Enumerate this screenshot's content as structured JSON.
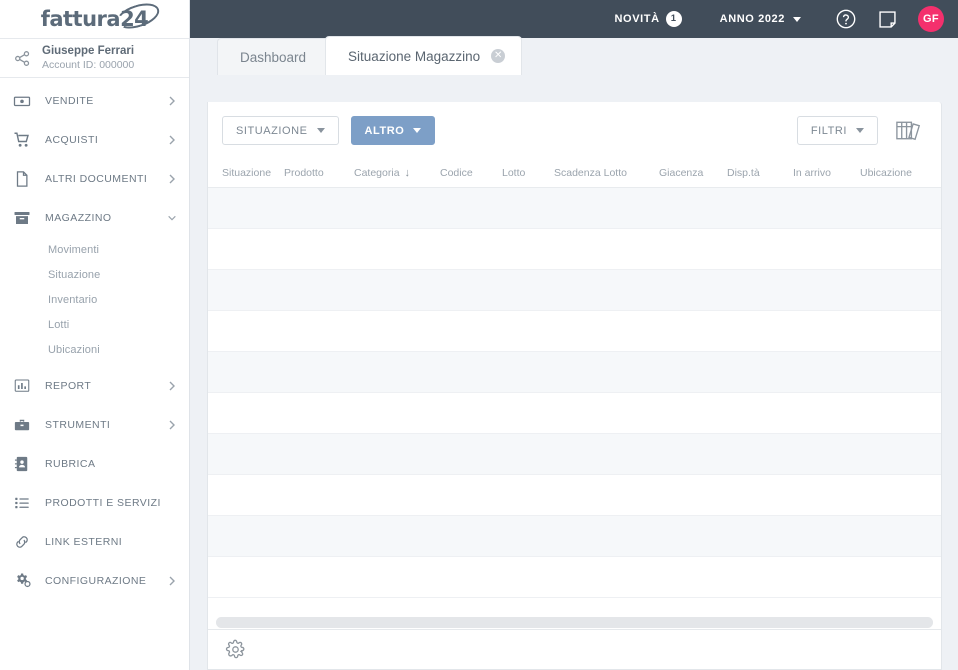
{
  "brand": {
    "logo_text": "fattura24",
    "logo_main": "fattura",
    "logo_suffix": "24"
  },
  "account": {
    "icon": "share-nodes-icon",
    "name": "Giuseppe Ferrari",
    "id_label": "Account ID: 000000"
  },
  "topbar": {
    "novita_label": "NOVITÀ",
    "novita_count": "1",
    "anno_label": "ANNO 2022",
    "help_icon": "question-circle-icon",
    "note_icon": "note-icon",
    "avatar_initials": "GF",
    "background": "#414d5a",
    "avatar_color": "#f4306d"
  },
  "sidebar": {
    "items": [
      {
        "label": "VENDITE",
        "icon": "banknote-icon",
        "expandable": true,
        "expanded": false
      },
      {
        "label": "ACQUISTI",
        "icon": "cart-icon",
        "expandable": true,
        "expanded": false
      },
      {
        "label": "ALTRI DOCUMENTI",
        "icon": "document-icon",
        "expandable": true,
        "expanded": false
      },
      {
        "label": "MAGAZZINO",
        "icon": "archive-box-icon",
        "expandable": true,
        "expanded": true
      },
      {
        "label": "REPORT",
        "icon": "bar-chart-icon",
        "expandable": true,
        "expanded": false
      },
      {
        "label": "STRUMENTI",
        "icon": "briefcase-icon",
        "expandable": true,
        "expanded": false
      },
      {
        "label": "RUBRICA",
        "icon": "address-book-icon",
        "expandable": false,
        "expanded": false
      },
      {
        "label": "PRODOTTI E SERVIZI",
        "icon": "list-icon",
        "expandable": false,
        "expanded": false
      },
      {
        "label": "LINK ESTERNI",
        "icon": "link-icon",
        "expandable": false,
        "expanded": false
      },
      {
        "label": "CONFIGURAZIONE",
        "icon": "gears-icon",
        "expandable": true,
        "expanded": false
      }
    ],
    "magazzino_subitems": [
      {
        "label": "Movimenti"
      },
      {
        "label": "Situazione"
      },
      {
        "label": "Inventario"
      },
      {
        "label": "Lotti"
      },
      {
        "label": "Ubicazioni"
      }
    ]
  },
  "tabs": [
    {
      "label": "Dashboard",
      "active": false,
      "closable": false
    },
    {
      "label": "Situazione Magazzino",
      "active": true,
      "closable": true
    }
  ],
  "toolbar": {
    "situazione_label": "SITUAZIONE",
    "altro_label": "ALTRO",
    "filtri_label": "FILTRI",
    "columns_icon": "book-columns-icon",
    "primary_color": "#7d9fc7"
  },
  "table": {
    "columns": [
      {
        "label": "Situazione",
        "width": 62,
        "sorted": false
      },
      {
        "label": "Prodotto",
        "width": 70,
        "sorted": false
      },
      {
        "label": "Categoria",
        "width": 86,
        "sorted": true,
        "sort_dir": "↓"
      },
      {
        "label": "Codice",
        "width": 62,
        "sorted": false
      },
      {
        "label": "Lotto",
        "width": 52,
        "sorted": false
      },
      {
        "label": "Scadenza Lotto",
        "width": 105,
        "sorted": false
      },
      {
        "label": "Giacenza",
        "width": 68,
        "sorted": false
      },
      {
        "label": "Disp.tà",
        "width": 66,
        "sorted": false
      },
      {
        "label": "In arrivo",
        "width": 67,
        "sorted": false
      },
      {
        "label": "Ubicazione",
        "width": 70,
        "sorted": false
      }
    ],
    "rows": [],
    "empty_row_count": 10
  },
  "footer": {
    "settings_icon": "gear-icon"
  }
}
